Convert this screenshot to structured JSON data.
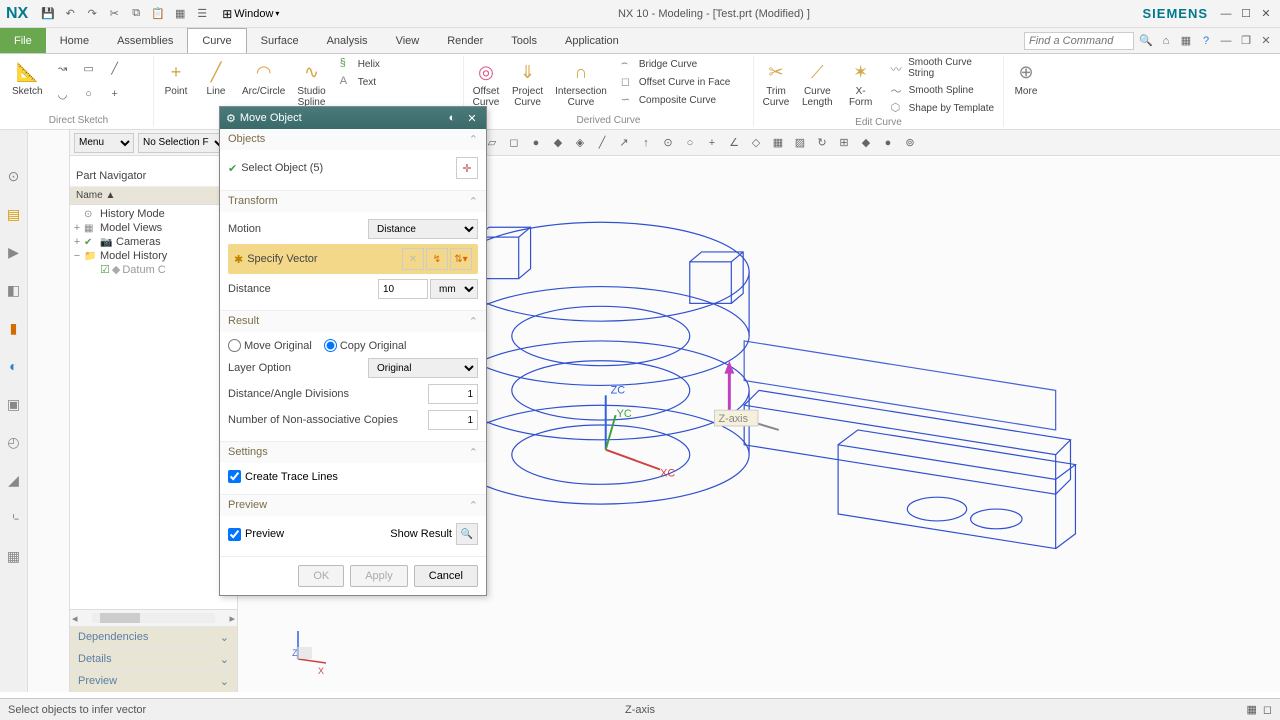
{
  "app": {
    "logo": "NX",
    "title": "NX 10 - Modeling - [Test.prt (Modified) ]",
    "brand": "SIEMENS",
    "window_dd": "Window"
  },
  "menu": {
    "file": "File",
    "tabs": [
      "Home",
      "Assemblies",
      "Curve",
      "Surface",
      "Analysis",
      "View",
      "Render",
      "Tools",
      "Application"
    ],
    "active_tab": "Curve",
    "search_ph": "Find a Command"
  },
  "ribbon": {
    "sketch": "Sketch",
    "direct_sketch": "Direct Sketch",
    "point": "Point",
    "line": "Line",
    "arc": "Arc/Circle",
    "studio": "Studio\nSpline",
    "helix": "Helix",
    "text": "Text",
    "offset_curve": "Offset\nCurve",
    "project_curve": "Project\nCurve",
    "intersection_curve": "Intersection\nCurve",
    "bridge": "Bridge Curve",
    "offset_face": "Offset Curve in Face",
    "composite": "Composite Curve",
    "derived_curve": "Derived Curve",
    "trim": "Trim\nCurve",
    "curve_length": "Curve\nLength",
    "xform": "X-Form",
    "smooth_string": "Smooth Curve String",
    "smooth_spline": "Smooth Spline",
    "shape_template": "Shape by Template",
    "edit_curve": "Edit Curve",
    "more": "More"
  },
  "filter": {
    "menu": "Menu",
    "nosel": "No Selection F"
  },
  "nav": {
    "title": "Part Navigator",
    "col": "Name   ▲",
    "history_mode": "History Mode",
    "model_views": "Model Views",
    "cameras": "Cameras",
    "model_history": "Model History",
    "datum": "Datum C",
    "sections": {
      "deps": "Dependencies",
      "details": "Details",
      "preview": "Preview"
    }
  },
  "dialog": {
    "title": "Move Object",
    "sec_objects": "Objects",
    "select_obj": "Select Object (5)",
    "sec_transform": "Transform",
    "motion": "Motion",
    "motion_val": "Distance",
    "specify_vector": "Specify Vector",
    "distance": "Distance",
    "distance_val": "10",
    "distance_unit": "mm",
    "sec_result": "Result",
    "move_original": "Move Original",
    "copy_original": "Copy Original",
    "layer_option": "Layer Option",
    "layer_val": "Original",
    "dist_angle_div": "Distance/Angle Divisions",
    "dist_angle_val": "1",
    "nonassoc": "Number of Non-associative Copies",
    "nonassoc_val": "1",
    "sec_settings": "Settings",
    "create_trace": "Create Trace Lines",
    "sec_preview": "Preview",
    "preview": "Preview",
    "show_result": "Show Result",
    "ok": "OK",
    "apply": "Apply",
    "cancel": "Cancel"
  },
  "viewport": {
    "zc": "ZC",
    "yc": "YC",
    "xc": "XC",
    "z": "Z",
    "x": "X",
    "zaxis_tip": "Z-axis"
  },
  "status": {
    "msg": "Select objects to infer vector",
    "mid": "Z-axis"
  }
}
